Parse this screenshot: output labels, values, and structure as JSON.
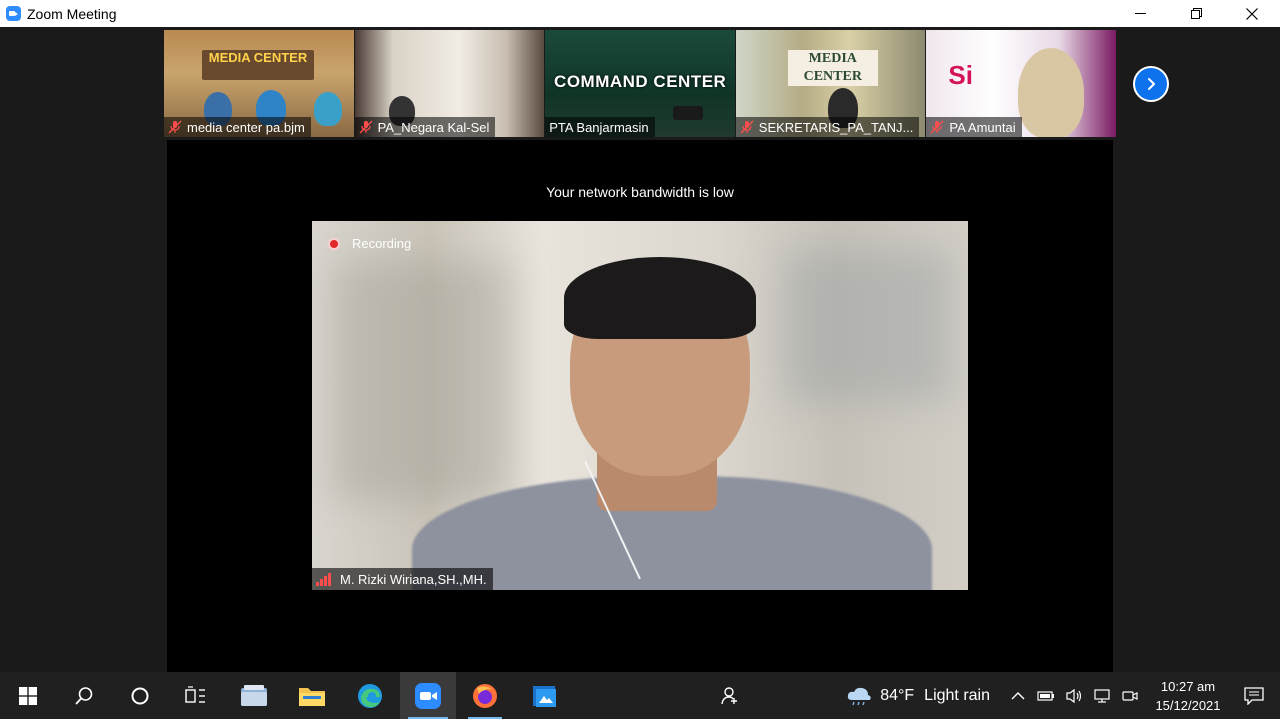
{
  "window": {
    "title": "Zoom Meeting"
  },
  "gallery": {
    "participants": [
      {
        "name": "media center pa.bjm",
        "sign": "MEDIA CENTER"
      },
      {
        "name": "PA_Negara Kal-Sel",
        "sign": ""
      },
      {
        "name": "PTA Banjarmasin",
        "sign": "COMMAND CENTER"
      },
      {
        "name": "SEKRETARIS_PA_TANJ...",
        "sign": "MEDIA CENTER"
      },
      {
        "name": "PA Amuntai",
        "sign": "Si"
      }
    ],
    "next_icon": "chevron-right-icon"
  },
  "stage": {
    "network_message": "Your network bandwidth is low",
    "recording_label": "Recording",
    "speaker_name": "M. Rizki Wiriana,SH.,MH."
  },
  "taskbar": {
    "apps": [
      "start",
      "search",
      "cortana",
      "task-view",
      "file-explorer",
      "folder",
      "edge",
      "zoom",
      "firefox",
      "photos"
    ],
    "weather": {
      "temp": "84°F",
      "condition": "Light rain"
    },
    "clock": {
      "time": "10:27 am",
      "date": "15/12/2021"
    }
  },
  "colors": {
    "zoom_blue": "#0e72ed",
    "recording_red": "#e02828",
    "muted_red": "#ff4d4d",
    "taskbar": "#202020"
  }
}
